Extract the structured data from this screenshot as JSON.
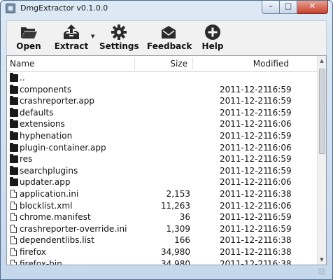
{
  "window": {
    "title": "DmgExtractor v0.1.0.0",
    "icon": "app-icon",
    "controls": {
      "minimize": "–",
      "maximize": "□",
      "close": "✕"
    }
  },
  "toolbar": {
    "open_label": "Open",
    "extract_label": "Extract",
    "settings_label": "Settings",
    "feedback_label": "Feedback",
    "help_label": "Help",
    "extract_dropdown": "▼"
  },
  "list": {
    "columns": {
      "name": "Name",
      "size": "Size",
      "modified": "Modified"
    },
    "rows": [
      {
        "type": "folder",
        "name": "..",
        "size": "",
        "date": "",
        "time": ""
      },
      {
        "type": "folder",
        "name": "components",
        "size": "",
        "date": "2011-12-21",
        "time": "16:59"
      },
      {
        "type": "folder",
        "name": "crashreporter.app",
        "size": "",
        "date": "2011-12-21",
        "time": "16:59"
      },
      {
        "type": "folder",
        "name": "defaults",
        "size": "",
        "date": "2011-12-21",
        "time": "16:59"
      },
      {
        "type": "folder",
        "name": "extensions",
        "size": "",
        "date": "2011-12-21",
        "time": "16:06"
      },
      {
        "type": "folder",
        "name": "hyphenation",
        "size": "",
        "date": "2011-12-21",
        "time": "16:59"
      },
      {
        "type": "folder",
        "name": "plugin-container.app",
        "size": "",
        "date": "2011-12-21",
        "time": "16:06"
      },
      {
        "type": "folder",
        "name": "res",
        "size": "",
        "date": "2011-12-21",
        "time": "16:59"
      },
      {
        "type": "folder",
        "name": "searchplugins",
        "size": "",
        "date": "2011-12-21",
        "time": "16:59"
      },
      {
        "type": "folder",
        "name": "updater.app",
        "size": "",
        "date": "2011-12-21",
        "time": "16:06"
      },
      {
        "type": "file",
        "name": "application.ini",
        "size": "2,153",
        "date": "2011-12-21",
        "time": "16:38"
      },
      {
        "type": "file",
        "name": "blocklist.xml",
        "size": "11,263",
        "date": "2011-12-21",
        "time": "16:06"
      },
      {
        "type": "file",
        "name": "chrome.manifest",
        "size": "36",
        "date": "2011-12-21",
        "time": "16:59"
      },
      {
        "type": "file",
        "name": "crashreporter-override.ini",
        "size": "1,309",
        "date": "2011-12-21",
        "time": "16:59"
      },
      {
        "type": "file",
        "name": "dependentlibs.list",
        "size": "166",
        "date": "2011-12-21",
        "time": "16:38"
      },
      {
        "type": "file",
        "name": "firefox",
        "size": "34,980",
        "date": "2011-12-21",
        "time": "16:38"
      },
      {
        "type": "file",
        "name": "firefox-bin",
        "size": "34,980",
        "date": "2011-12-21",
        "time": "16:38"
      }
    ]
  },
  "scrollbar": {
    "up": "▲",
    "down": "▼"
  }
}
